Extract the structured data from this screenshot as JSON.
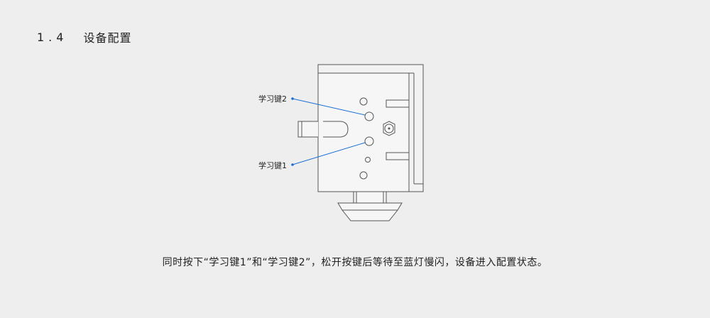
{
  "section": {
    "number": "1.4",
    "title": "设备配置"
  },
  "figure": {
    "callout_top": "学习键2",
    "callout_bottom": "学习键1"
  },
  "caption": "同时按下“学习键1”和“学习键2”，松开按键后等待至蓝灯慢闪，设备进入配置状态。",
  "colors": {
    "background": "#eeeeee",
    "line": "#555555",
    "callout": "#1a6fd6"
  }
}
